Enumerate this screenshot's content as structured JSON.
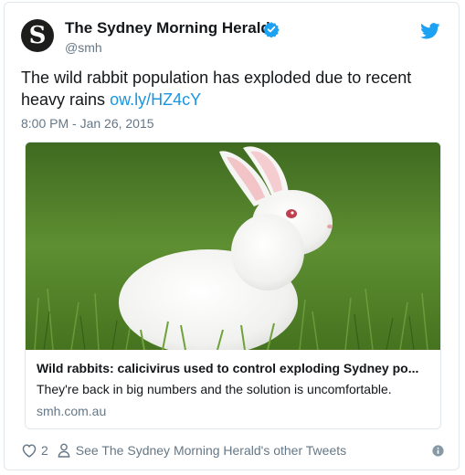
{
  "account": {
    "name": "The Sydney Morning Herald",
    "handle": "@smh",
    "avatar_letter": "S",
    "verified_icon": "verified-badge-icon"
  },
  "tweet": {
    "text": "The wild rabbit population has exploded due to recent heavy rains",
    "link": "ow.ly/HZ4cY",
    "timestamp": "8:00 PM - Jan 26, 2015"
  },
  "card": {
    "image": "white-rabbit-in-grass",
    "title": "Wild rabbits: calicivirus used to control exploding Sydney po...",
    "description": "They're back in big numbers and the solution is uncomfortable.",
    "domain": "smh.com.au"
  },
  "footer": {
    "like_count": "2",
    "see_more": "See The Sydney Morning Herald's other Tweets"
  },
  "colors": {
    "link": "#1b95e0",
    "twitter_blue": "#1da1f2",
    "muted": "#657786"
  }
}
